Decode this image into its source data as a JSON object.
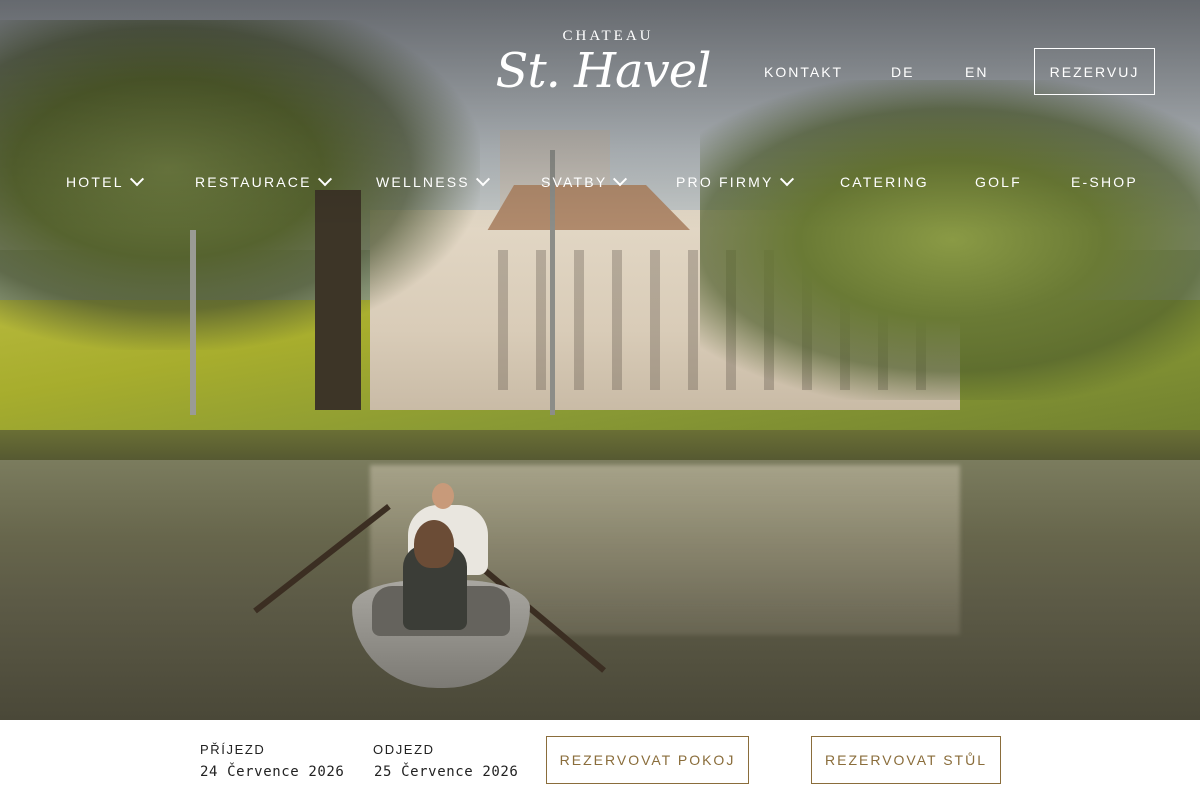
{
  "logo": {
    "small": "CHATEAU",
    "big": "St. Havel"
  },
  "top_links": {
    "kontakt": "KONTAKT",
    "de": "DE",
    "en": "EN",
    "reserve": "REZERVUJ"
  },
  "nav": [
    {
      "label": "HOTEL",
      "has_dropdown": true
    },
    {
      "label": "RESTAURACE",
      "has_dropdown": true
    },
    {
      "label": "WELLNESS",
      "has_dropdown": true
    },
    {
      "label": "SVATBY",
      "has_dropdown": true
    },
    {
      "label": "PRO FIRMY",
      "has_dropdown": true
    },
    {
      "label": "CATERING",
      "has_dropdown": false
    },
    {
      "label": "GOLF",
      "has_dropdown": false
    },
    {
      "label": "E-SHOP",
      "has_dropdown": false
    }
  ],
  "booking": {
    "arrival_label": "PŘÍJEZD",
    "arrival_value": "24 Července 2026",
    "departure_label": "ODJEZD",
    "departure_value": "25 Července 2026",
    "book_room": "REZERVOVAT POKOJ",
    "book_table": "REZERVOVAT STŮL"
  },
  "colors": {
    "accent": "#8a6d3b",
    "nav_text": "#ffffff"
  },
  "icons": {
    "dropdown": "chevron-down-icon"
  }
}
